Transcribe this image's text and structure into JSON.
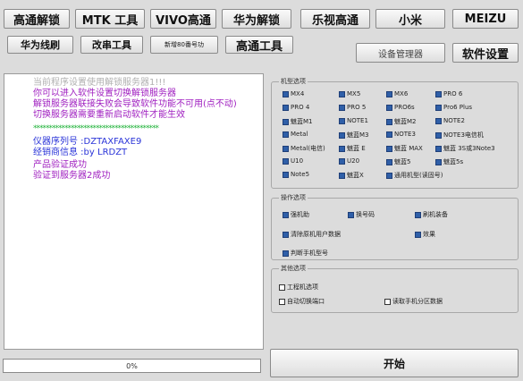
{
  "toolbar": {
    "row1": [
      "高通解锁",
      "MTK 工具",
      "VIVO高通",
      "华为解锁",
      "乐视高通",
      "小米",
      "MEIZU"
    ],
    "row2": [
      "华为线刷",
      "改串工具",
      "新增80番号功",
      "高通工具"
    ],
    "device_manager": "设备管理器",
    "settings": "软件设置"
  },
  "log": {
    "lines": [
      "当前程序设置使用解锁服务器1!!!",
      "你可以进入软件设置切换解锁服务器",
      "解锁服务器联接失败会导致软件功能不可用(点不动)",
      "切换服务器需要重新启动软件才能生效",
      "****************************************",
      "仪器序列号 :DZTAXFAXE9",
      "经销商信息 :by LRDZT",
      "产品验证成功",
      "验证到服务器2成功"
    ]
  },
  "models": {
    "title": "机型选项",
    "items": [
      "MX4",
      "MX5",
      "MX6",
      "PRO 6",
      "PRO 4",
      "PRO 5",
      "PRO6s",
      "Pro6 Plus",
      "魅蓝M1",
      "NOTE1",
      "魅蓝M2",
      "NOTE2",
      "Metal",
      "魅蓝M3",
      "NOTE3",
      "NOTE3电信机",
      "Metal(电信)",
      "魅蓝 E",
      "魅蓝 MAX",
      "魅蓝 3S或3Note3",
      "U10",
      "U20",
      "魅蓝5",
      "魅蓝5s",
      "Note5",
      "魅蓝X",
      "通用机型(读固号)"
    ]
  },
  "ops": {
    "title": "操作选项",
    "items": [
      "强机助",
      "换号码",
      "刷机装备",
      "清除原机用户数据",
      "效果",
      "判断手机型号"
    ]
  },
  "other": {
    "title": "其他选项",
    "items": [
      "工程机选项",
      "自动切换端口",
      "读取手机分区数据"
    ]
  },
  "progress": {
    "value": "0%"
  },
  "start_label": "开始"
}
